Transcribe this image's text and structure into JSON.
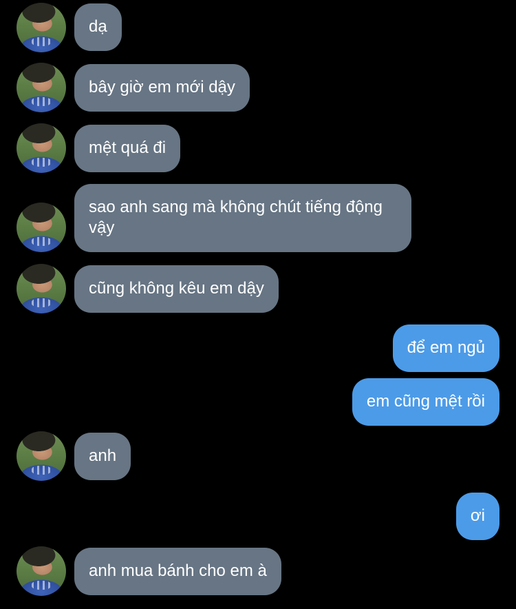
{
  "conversation": {
    "messages": [
      {
        "from": "them",
        "text": "dạ"
      },
      {
        "from": "them",
        "text": "bây giờ em mới dậy"
      },
      {
        "from": "them",
        "text": "mệt quá đi"
      },
      {
        "from": "them",
        "text": "sao anh sang mà không chút tiếng động vậy"
      },
      {
        "from": "them",
        "text": "cũng không kêu em dậy"
      },
      {
        "from": "me",
        "text": "để em ngủ"
      },
      {
        "from": "me",
        "text": "em cũng mệt rồi"
      },
      {
        "from": "them",
        "text": "anh"
      },
      {
        "from": "me",
        "text": "ơi"
      },
      {
        "from": "them",
        "text": "anh mua bánh cho em à"
      }
    ]
  },
  "colors": {
    "background": "#000000",
    "incoming_bubble": "#677584",
    "outgoing_bubble": "#4c9be8",
    "text": "#ffffff"
  },
  "icons": {
    "avatar": "contact-avatar-photo"
  }
}
